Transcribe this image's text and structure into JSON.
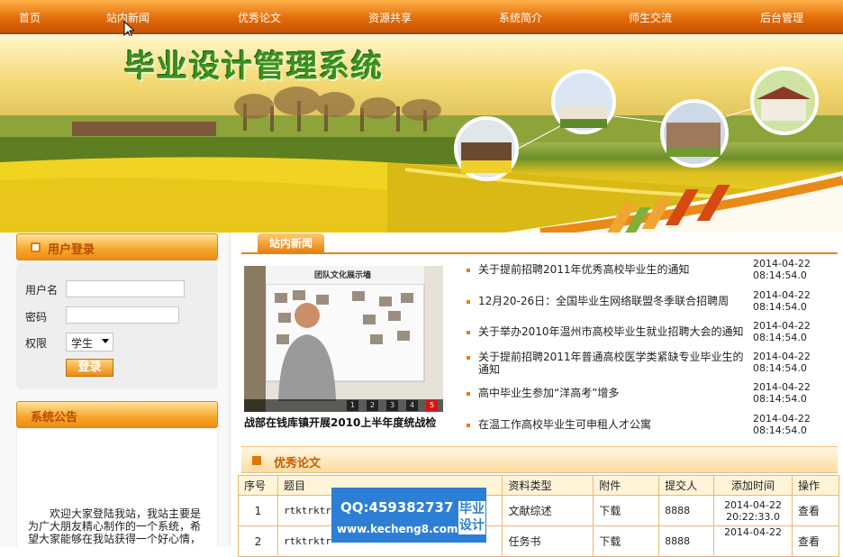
{
  "nav": {
    "items": [
      "首页",
      "站内新闻",
      "优秀论文",
      "资源共享",
      "系统简介",
      "师生交流",
      "后台管理"
    ]
  },
  "banner": {
    "site_title": "毕业设计管理系统"
  },
  "login": {
    "title": "用户登录",
    "username_label": "用户名",
    "password_label": "密码",
    "role_label": "权限",
    "role_value": "学生",
    "submit_label": "登录"
  },
  "notice": {
    "title": "系统公告",
    "text": "欢迎大家登陆我站，我站主要是为广大朋友精心制作的一个系统，希望大家能够在我站获得一个好心情，"
  },
  "news": {
    "tab": "站内新闻",
    "photo_caption": "战部在钱库镇开展2010上半年度统战检",
    "photo_title": "团队文化展示墙",
    "pager": [
      "1",
      "2",
      "3",
      "4",
      "5"
    ],
    "items": [
      {
        "title": "关于提前招聘2011年优秀高校毕业生的通知",
        "date": "2014-04-22",
        "time": "08:14:54.0"
      },
      {
        "title": "12月20-26日：全国毕业生网络联盟冬季联合招聘周",
        "date": "2014-04-22",
        "time": "08:14:54.0"
      },
      {
        "title": "关于举办2010年温州市高校毕业生就业招聘大会的通知",
        "date": "2014-04-22",
        "time": "08:14:54.0"
      },
      {
        "title": "关于提前招聘2011年普通高校医学类紧缺专业毕业生的通知",
        "date": "2014-04-22",
        "time": "08:14:54.0"
      },
      {
        "title": "高中毕业生参加“洋高考”增多",
        "date": "2014-04-22",
        "time": "08:14:54.0"
      },
      {
        "title": "在温工作高校毕业生可申租人才公寓",
        "date": "2014-04-22",
        "time": "08:14:54.0"
      }
    ]
  },
  "papers": {
    "title": "优秀论文",
    "headers": [
      "序号",
      "题目",
      "资料类型",
      "附件",
      "提交人",
      "添加时间",
      "操作"
    ],
    "rows": [
      {
        "no": "1",
        "title": "rtktrktr",
        "type": "文献综述",
        "attach": "下载",
        "user": "8888",
        "date": "2014-04-22",
        "time": "20:22:33.0",
        "op": "查看"
      },
      {
        "no": "2",
        "title": "rtktrktr",
        "type": "任务书",
        "attach": "下载",
        "user": "8888",
        "date": "2014-04-22",
        "time": "",
        "op": "查看"
      }
    ]
  },
  "ad": {
    "qq": "QQ:459382737",
    "url": "www.kecheng8.com",
    "badge_line1": "毕业",
    "badge_line2": "设计"
  }
}
